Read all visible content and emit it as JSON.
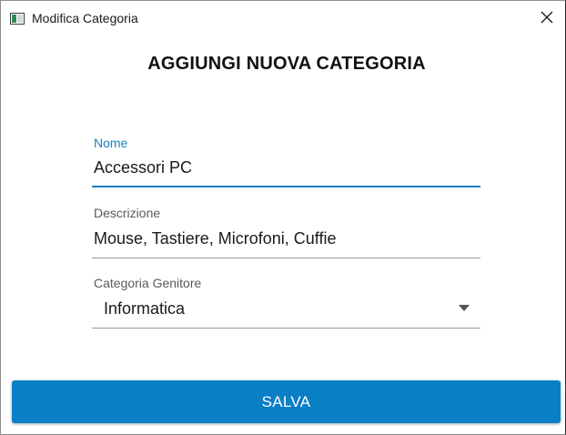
{
  "window": {
    "title": "Modifica Categoria"
  },
  "dialog": {
    "heading": "AGGIUNGI NUOVA CATEGORIA"
  },
  "form": {
    "nome": {
      "label": "Nome",
      "value": "Accessori PC",
      "focused": true
    },
    "descrizione": {
      "label": "Descrizione",
      "value": "Mouse, Tastiere, Microfoni, Cuffie"
    },
    "categoria_genitore": {
      "label": "Categoria Genitore",
      "selected": "Informatica"
    }
  },
  "actions": {
    "save_label": "SALVA"
  },
  "icons": {
    "app": "window-app-icon",
    "close": "close-icon",
    "dropdown": "chevron-down-icon"
  },
  "colors": {
    "accent": "#1c7fbd",
    "button": "#0a7fc6",
    "button_text": "#ffffff",
    "background": "#ffffff"
  }
}
